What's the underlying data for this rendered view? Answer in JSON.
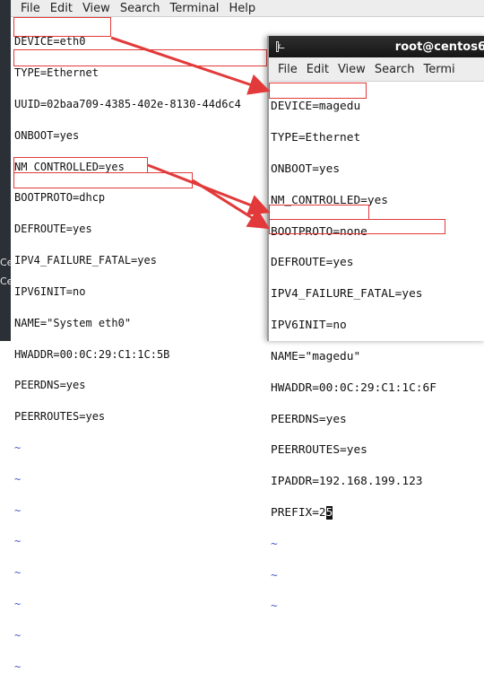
{
  "desktop": {
    "side_text_1": "Ce",
    "side_text_2": "Ce"
  },
  "bg_terminal": {
    "menu": [
      "File",
      "Edit",
      "View",
      "Search",
      "Terminal",
      "Help"
    ],
    "lines": [
      "DEVICE=eth0",
      "TYPE=Ethernet",
      "UUID=02baa709-4385-402e-8130-44d6c4",
      "ONBOOT=yes",
      "NM_CONTROLLED=yes",
      "BOOTPROTO=dhcp",
      "DEFROUTE=yes",
      "IPV4_FAILURE_FATAL=yes",
      "IPV6INIT=no",
      "NAME=\"System eth0\"",
      "HWADDR=00:0C:29:C1:1C:5B",
      "PEERDNS=yes",
      "PEERROUTES=yes"
    ],
    "tilde": "~"
  },
  "fg_terminal": {
    "title": "root@centos6",
    "menu": [
      "File",
      "Edit",
      "View",
      "Search",
      "Termi"
    ],
    "lines": [
      "DEVICE=magedu",
      "TYPE=Ethernet",
      "ONBOOT=yes",
      "NM_CONTROLLED=yes",
      "BOOTPROTO=none",
      "DEFROUTE=yes",
      "IPV4_FAILURE_FATAL=yes",
      "IPV6INIT=no",
      "NAME=\"magedu\"",
      "HWADDR=00:0C:29:C1:1C:6F",
      "PEERDNS=yes",
      "PEERROUTES=yes",
      "IPADDR=192.168.199.123"
    ],
    "last_line_prefix": "PREFIX=2",
    "last_line_cursor": "5",
    "tilde": "~"
  },
  "colors": {
    "annotation": "#e23a3a",
    "tilde": "#4b56c8"
  }
}
